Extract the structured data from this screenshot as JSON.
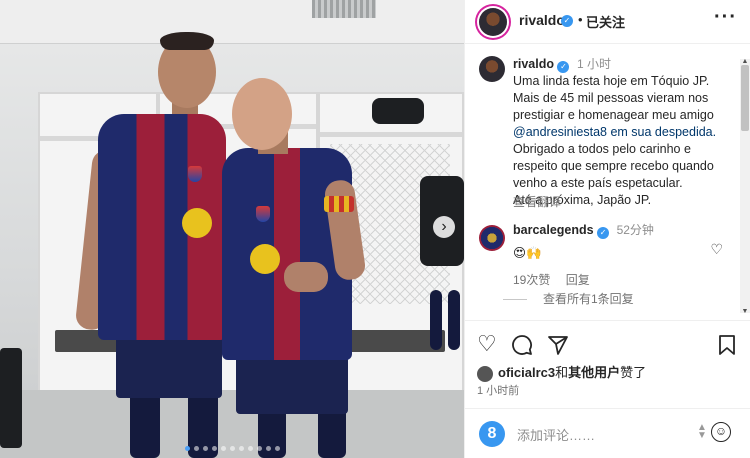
{
  "post": {
    "username": "rivaldo",
    "follow_status": "已关注",
    "more_label": "···"
  },
  "caption": {
    "username": "rivaldo",
    "time": "1 小时",
    "lines": [
      "Uma linda festa hoje em Tóquio JP.",
      "Mais de 45 mil pessoas vieram nos",
      "prestigiar e homenagear meu amigo",
      "@andresiniesta8 em sua despedida.",
      "Obrigado a todos pelo carinho e",
      "respeito que sempre recebo quando",
      "venho a este país espetacular.",
      "Até a próxima, Japão JP."
    ],
    "translate_label": "查看翻译"
  },
  "comment": {
    "username": "barcalegends",
    "time": "52分钟",
    "text": "😍🙌",
    "likes": "19次赞",
    "reply_label": "回复",
    "view_replies": "查看所有1条回复"
  },
  "likes": {
    "user": "oficialrc3",
    "connector": "和",
    "others": "其他用户",
    "suffix": "赞了"
  },
  "posted_time": "1 小时前",
  "add_comment": {
    "badge": "8",
    "placeholder": "添加评论……"
  },
  "icons": {
    "heart": "heart-icon",
    "comment": "comment-icon",
    "share": "share-icon",
    "save": "bookmark-icon",
    "emoji": "emoji-icon",
    "next": "chevron-right-icon"
  },
  "carousel": {
    "total": 11,
    "active": 1
  }
}
